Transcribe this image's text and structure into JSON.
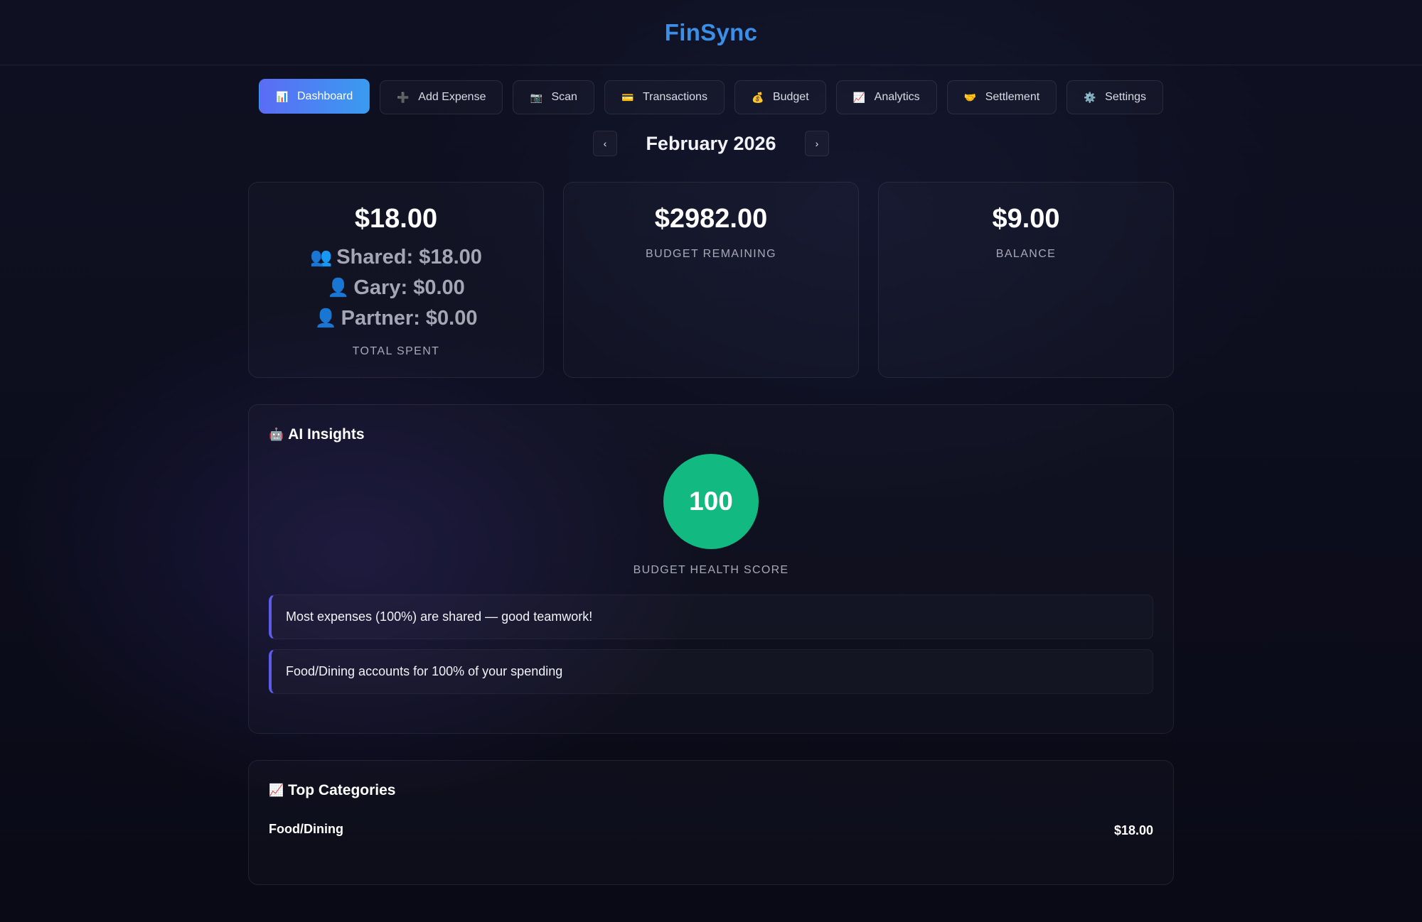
{
  "app": {
    "title": "FinSync",
    "brand_color": "#3b8fe6"
  },
  "nav": {
    "items": [
      {
        "label": "Dashboard",
        "icon": "📊",
        "icon_name": "bar-chart-icon",
        "active": true
      },
      {
        "label": "Add Expense",
        "icon": "➕",
        "icon_name": "plus-icon",
        "active": false
      },
      {
        "label": "Scan",
        "icon": "📷",
        "icon_name": "camera-icon",
        "active": false
      },
      {
        "label": "Transactions",
        "icon": "💳",
        "icon_name": "credit-card-icon",
        "active": false
      },
      {
        "label": "Budget",
        "icon": "💰",
        "icon_name": "money-bag-icon",
        "active": false
      },
      {
        "label": "Analytics",
        "icon": "📈",
        "icon_name": "chart-up-icon",
        "active": false
      },
      {
        "label": "Settlement",
        "icon": "🤝",
        "icon_name": "handshake-icon",
        "active": false
      },
      {
        "label": "Settings",
        "icon": "⚙️",
        "icon_name": "gear-icon",
        "active": false
      }
    ]
  },
  "month": {
    "label": "February 2026",
    "prev": "‹",
    "next": "›"
  },
  "stats": {
    "total": {
      "value": "$18.00",
      "shared_icon": "👥",
      "shared": "Shared: $18.00",
      "gary_icon": "👤",
      "gary": "Gary: $0.00",
      "partner_icon": "👤",
      "partner": "Partner: $0.00",
      "label": "TOTAL SPENT"
    },
    "budget_remaining": {
      "value": "$2982.00",
      "label": "BUDGET REMAINING"
    },
    "balance": {
      "value": "$9.00",
      "label": "BALANCE"
    }
  },
  "insights": {
    "icon": "🤖",
    "title": "AI Insights",
    "score": "100",
    "score_label": "BUDGET HEALTH SCORE",
    "score_color": "#12b981",
    "items": [
      "Most expenses (100%) are shared — good teamwork!",
      "Food/Dining accounts for 100% of your spending"
    ]
  },
  "categories": {
    "icon": "📈",
    "title": "Top Categories",
    "rows": [
      {
        "name": "Food/Dining",
        "amount": "$18.00"
      }
    ]
  }
}
